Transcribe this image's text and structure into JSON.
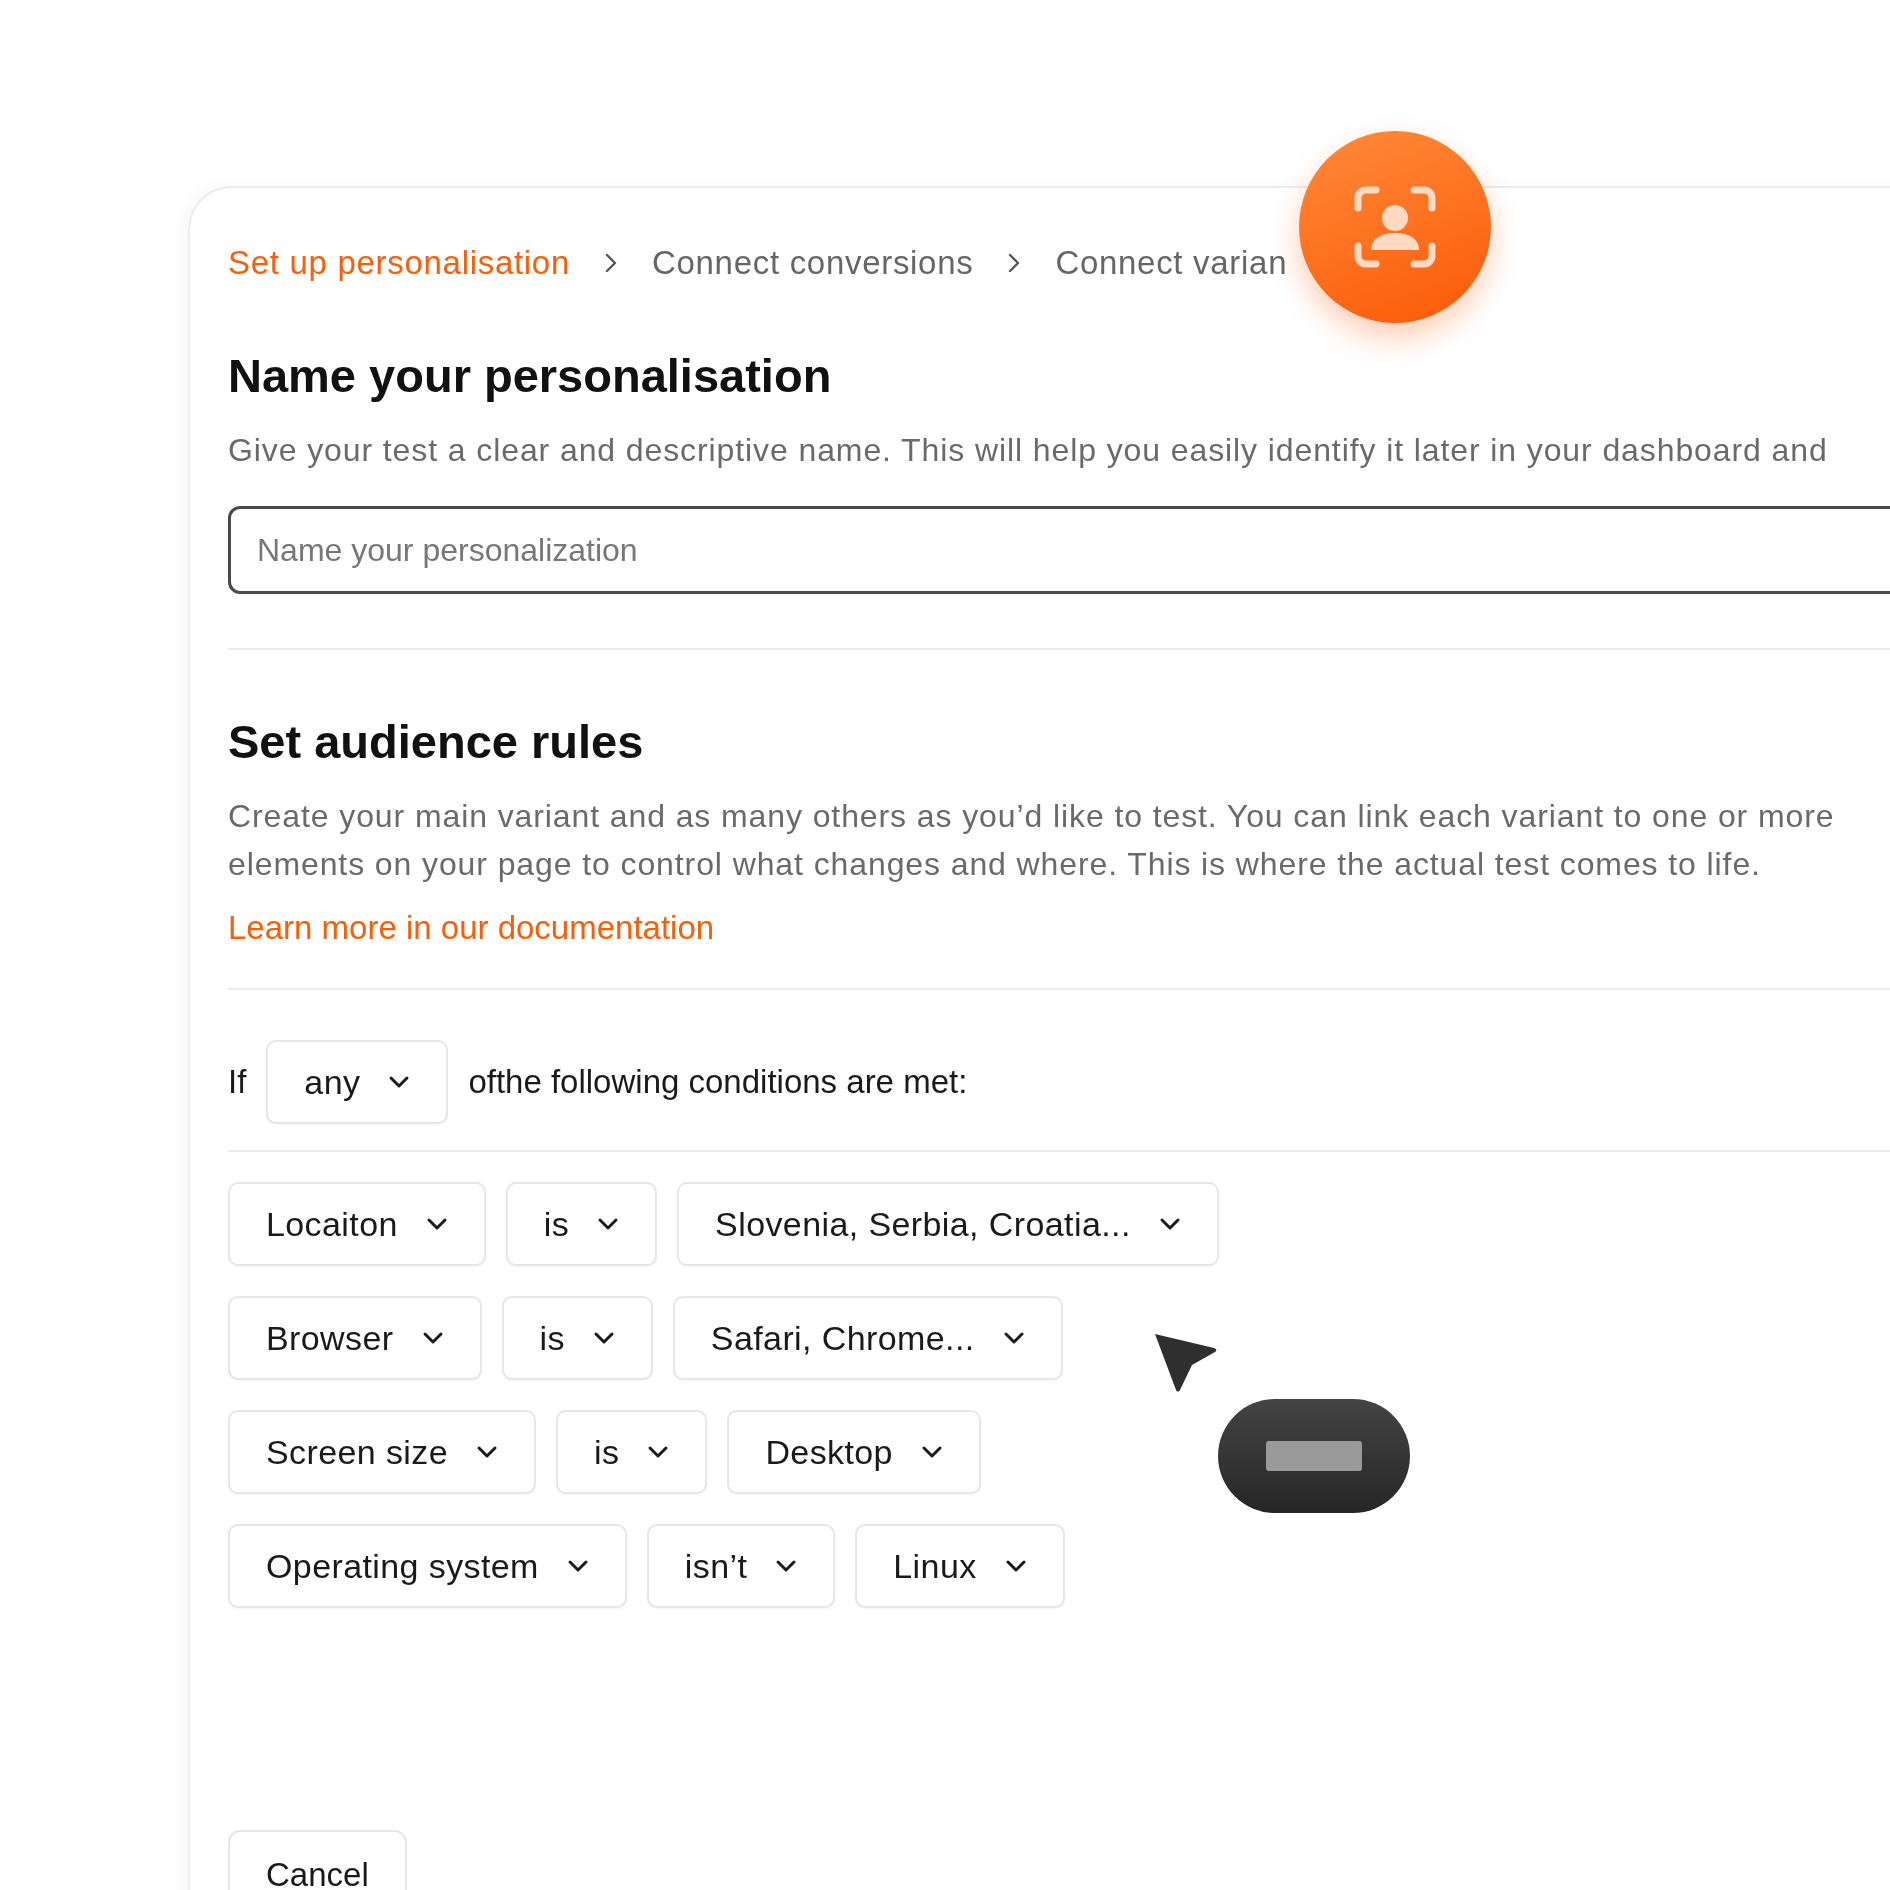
{
  "breadcrumb": [
    {
      "label": "Set up personalisation",
      "selected": true
    },
    {
      "label": "Connect conversions",
      "selected": false
    },
    {
      "label": "Connect varian",
      "selected": false
    }
  ],
  "name_section": {
    "title": "Name your personalisation",
    "description": "Give your test a clear and descriptive name. This will help you easily identify it later in your dashboard and",
    "input": {
      "placeholder": "Name your personalization"
    }
  },
  "audience_section": {
    "title": "Set audience rules",
    "description": "Create your main variant and as many others as you’d like to test. You can link each variant to one or more\nelements on your page to control what changes and where. This is where the actual test comes to life.",
    "link": "Learn more in our documentation"
  },
  "condition": {
    "prefix": "If",
    "match": "any",
    "suffix": "ofthe following conditions are met:"
  },
  "rules": [
    {
      "field": "Locaiton",
      "operator": "is",
      "value": "Slovenia, Serbia, Croatia..."
    },
    {
      "field": "Browser",
      "operator": "is",
      "value": "Safari, Chrome..."
    },
    {
      "field": "Screen size",
      "operator": "is",
      "value": "Desktop"
    },
    {
      "field": "Operating system",
      "operator": "isn’t",
      "value": "Linux"
    }
  ],
  "buttons": [
    "Cancel"
  ]
}
